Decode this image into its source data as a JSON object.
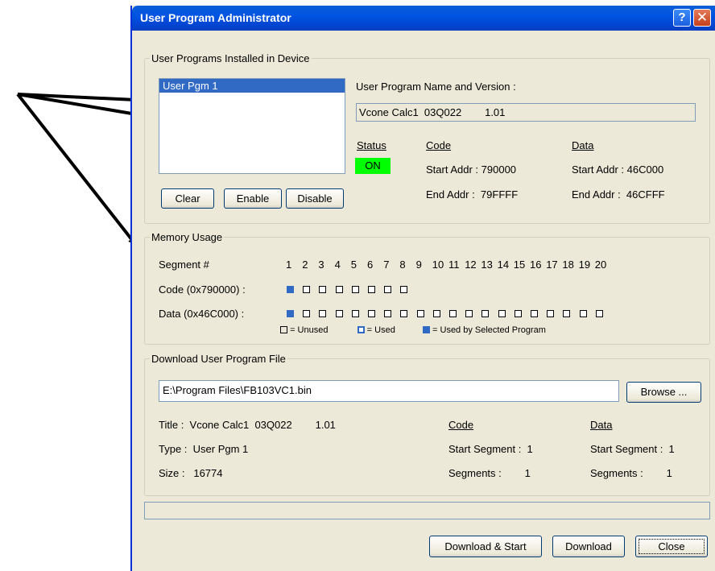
{
  "window": {
    "title": "User Program Administrator",
    "help_label": "?",
    "close_label": "✕"
  },
  "installed": {
    "legend": "User Programs Installed in Device",
    "programs": [
      "User Pgm 1"
    ],
    "name_version_label": "User Program Name and Version :",
    "name_version_value": "Vcone Calc1  03Q022        1.01",
    "status_label": "Status",
    "status_value": "ON",
    "status_color": "#00ff00",
    "code_label": "Code",
    "data_label": "Data",
    "code_start": "Start Addr : 790000",
    "code_end": "End Addr :  79FFFF",
    "data_start": "Start Addr : 46C000",
    "data_end": "End Addr :  46CFFF",
    "buttons": {
      "clear": "Clear",
      "enable": "Enable",
      "disable": "Disable"
    }
  },
  "memory": {
    "legend": "Memory Usage",
    "segment_label": "Segment #",
    "segment_numbers": [
      "1",
      "2",
      "3",
      "4",
      "5",
      "6",
      "7",
      "8",
      "9",
      "10",
      "11",
      "12",
      "13",
      "14",
      "15",
      "16",
      "17",
      "18",
      "19",
      "20"
    ],
    "code_row_label": "Code (0x790000) :",
    "data_row_label": "Data (0x46C000) :",
    "code_segments": [
      "selected",
      "unused",
      "unused",
      "unused",
      "unused",
      "unused",
      "unused",
      "unused"
    ],
    "data_segments": [
      "selected",
      "unused",
      "unused",
      "unused",
      "unused",
      "unused",
      "unused",
      "unused",
      "unused",
      "unused",
      "unused",
      "unused",
      "unused",
      "unused",
      "unused",
      "unused",
      "unused",
      "unused",
      "unused",
      "unused"
    ],
    "key_unused": "= Unused",
    "key_used": "= Used",
    "key_selected": "= Used by Selected Program",
    "selected_color": "#316ac5"
  },
  "download": {
    "legend": "Download User Program File",
    "file_path": "E:\\Program Files\\FB103VC1.bin",
    "browse_label": "Browse ...",
    "title_line": "Title :  Vcone Calc1  03Q022        1.01",
    "type_line": "Type :  User Pgm 1",
    "size_line": "Size :   16774",
    "code_label": "Code",
    "data_label": "Data",
    "code_start_seg": "Start Segment :  1",
    "code_segments": "Segments :        1",
    "data_start_seg": "Start Segment :  1",
    "data_segments": "Segments :        1"
  },
  "footer": {
    "download_start": "Download & Start",
    "download": "Download",
    "close": "Close"
  }
}
